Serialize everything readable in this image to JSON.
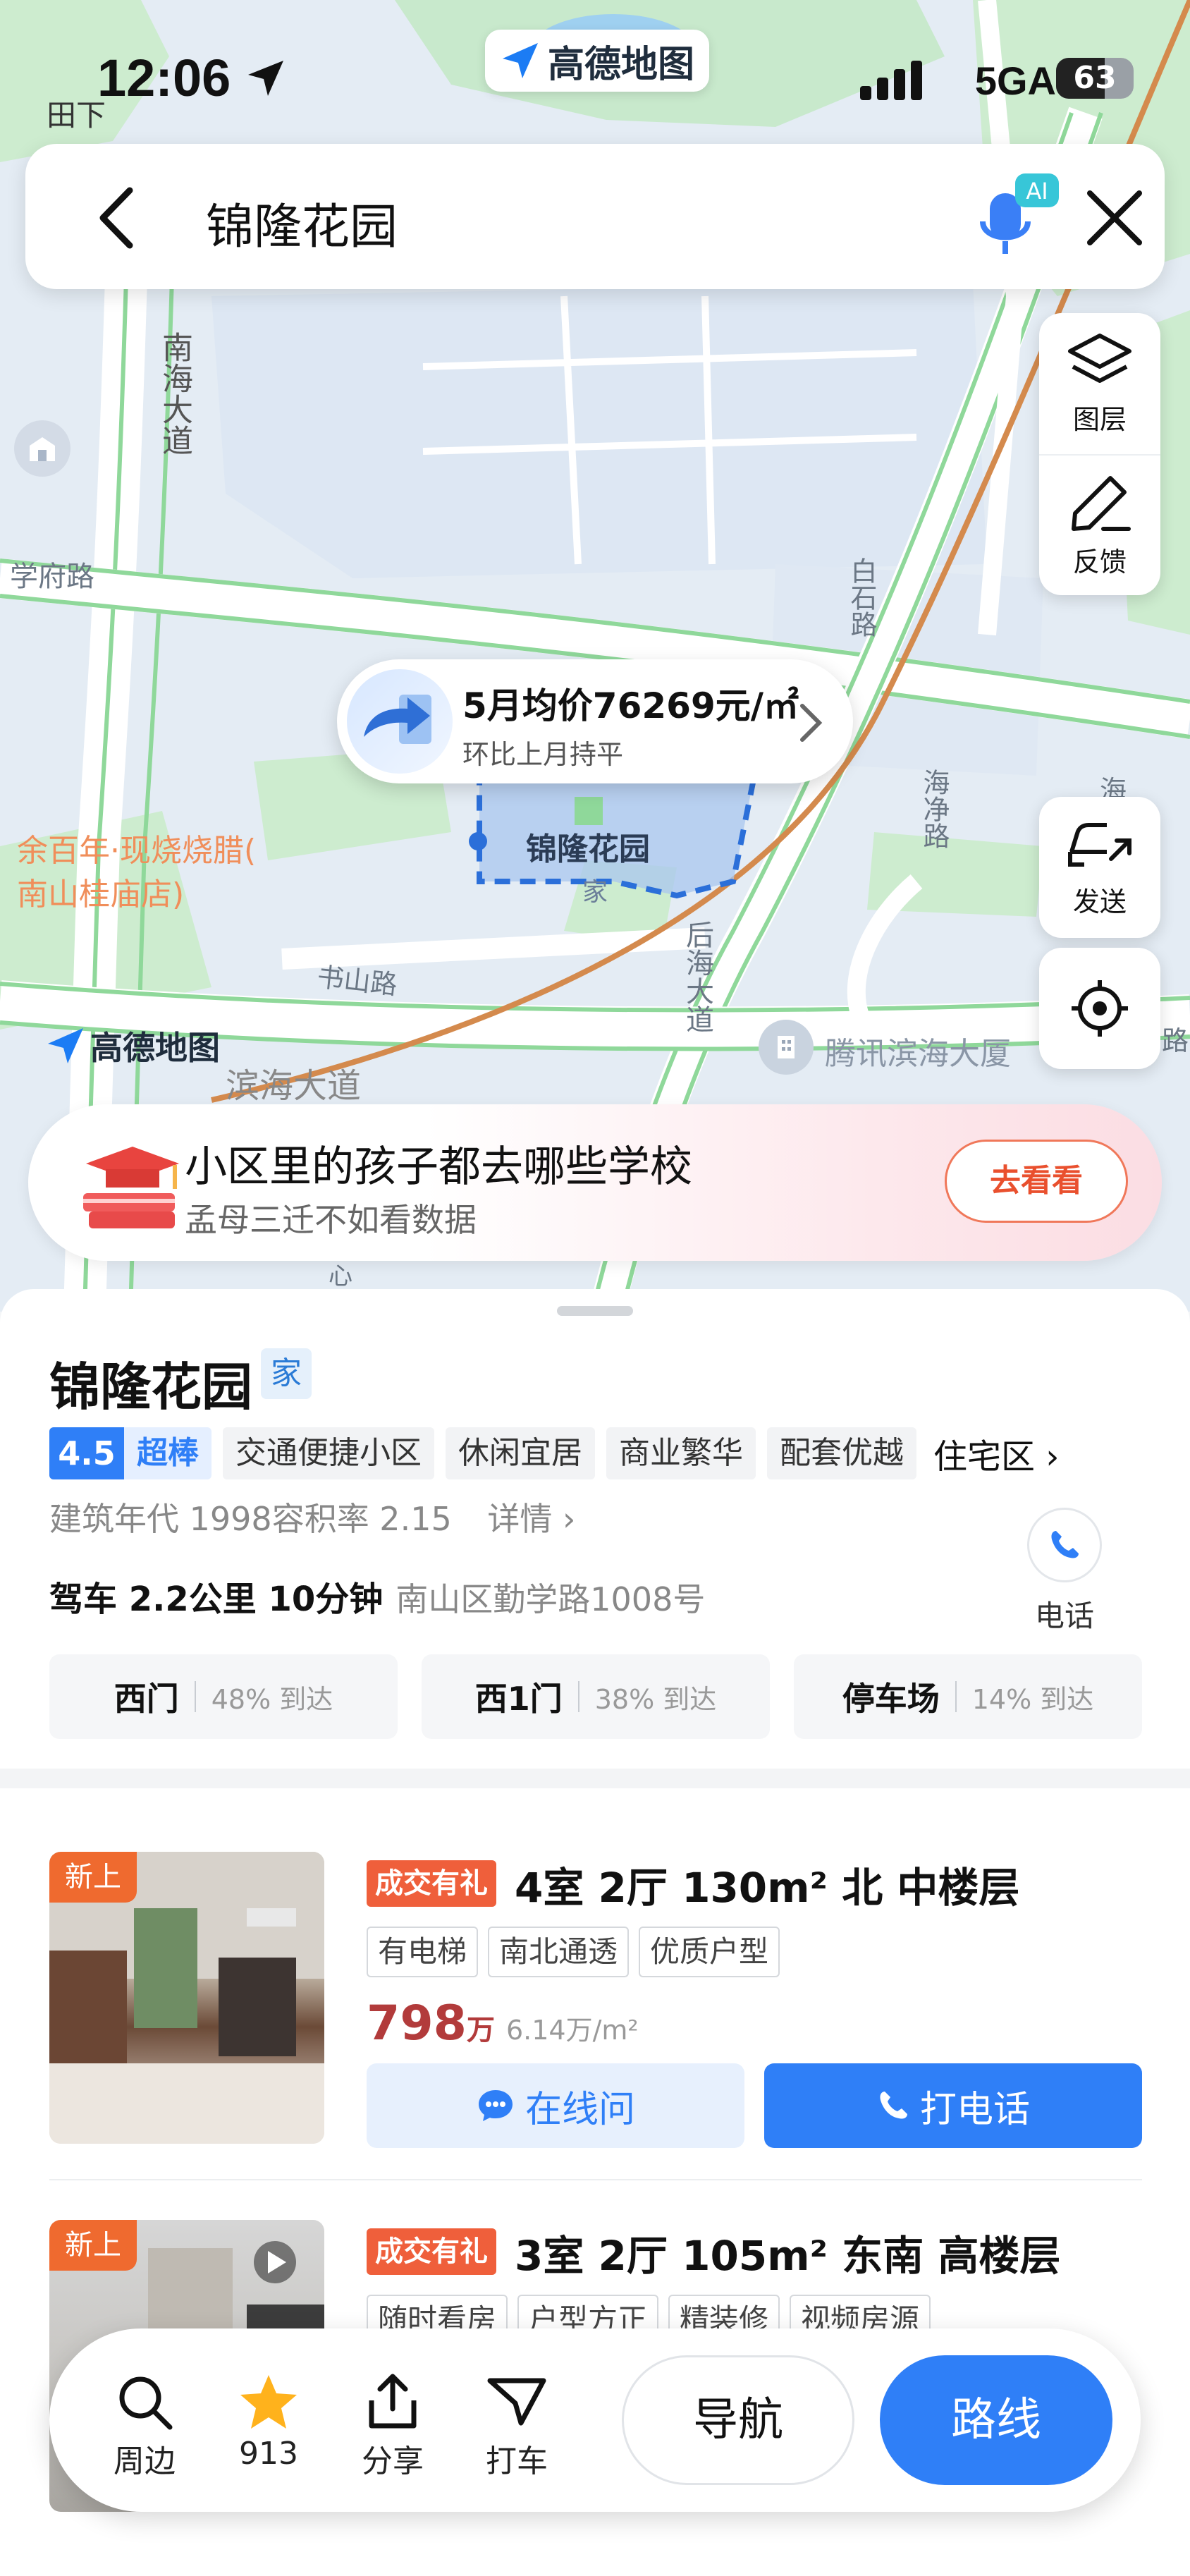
{
  "status_bar": {
    "time": "12:06",
    "network": "5GA",
    "battery": "63",
    "battery_level": 0.63,
    "brand": "高德地图"
  },
  "search": {
    "query": "锦隆花园"
  },
  "map_tools": {
    "layers": "图层",
    "feedback": "反馈",
    "send": "发送"
  },
  "map_labels": {
    "tianxia": "田下",
    "nanhai": "南海大道",
    "xuefu": "学府路",
    "baishi": "白石路",
    "haijing": "海净路",
    "hai": "海",
    "yubainian": "余百年·现烧烧腊(",
    "yubainian2": "南山桂庙店)",
    "shushan": "书山路",
    "binhai": "滨海大道",
    "houhai": "后海大道",
    "tencent": "腾讯滨海大厦",
    "map_brand": "高德地图",
    "poi_name": "锦隆花园",
    "poi_tag": "家",
    "lu": "路",
    "xin": "心"
  },
  "price_bubble": {
    "price": "5月均价76269元/㎡",
    "change": "环比上月持平"
  },
  "banner": {
    "title": "小区里的孩子都去哪些学校",
    "subtitle": "孟母三迁不如看数据",
    "button": "去看看"
  },
  "place": {
    "name": "锦隆花园",
    "home_tag": "家",
    "rating": "4.5",
    "rating_word": "超棒",
    "tags": [
      "交通便捷小区",
      "休闲宜居",
      "商业繁华",
      "配套优越"
    ],
    "category": "住宅区",
    "info": "建筑年代 1998容积率 2.15",
    "detail": "详情",
    "drive": "驾车 2.2公里 10分钟",
    "address": "南山区勤学路1008号",
    "phone_label": "电话"
  },
  "gates": [
    {
      "name": "西门",
      "pct": "48% 到达"
    },
    {
      "name": "西1门",
      "pct": "38% 到达"
    },
    {
      "name": "停车场",
      "pct": "14% 到达"
    }
  ],
  "listings": [
    {
      "badge": "新上",
      "deal": "成交有礼",
      "title": "4室 2厅 130m² 北 中楼层",
      "features": [
        "有电梯",
        "南北通透",
        "优质户型"
      ],
      "price": "798",
      "price_unit": "万",
      "unit_price": "6.14万/m²",
      "ask": "在线问",
      "call": "打电话"
    },
    {
      "badge": "新上",
      "deal": "成交有礼",
      "title": "3室 2厅 105m² 东南 高楼层",
      "features": [
        "随时看房",
        "户型方正",
        "精装修",
        "视频房源"
      ]
    }
  ],
  "actions": {
    "nearby": "周边",
    "favorites": "913",
    "share": "分享",
    "taxi": "打车",
    "navigate": "导航",
    "route": "路线"
  },
  "colors": {
    "accent": "#2f7ff7",
    "deal": "#ef5f3b",
    "price": "#b23b3b",
    "banner_button": "#e9502e"
  }
}
